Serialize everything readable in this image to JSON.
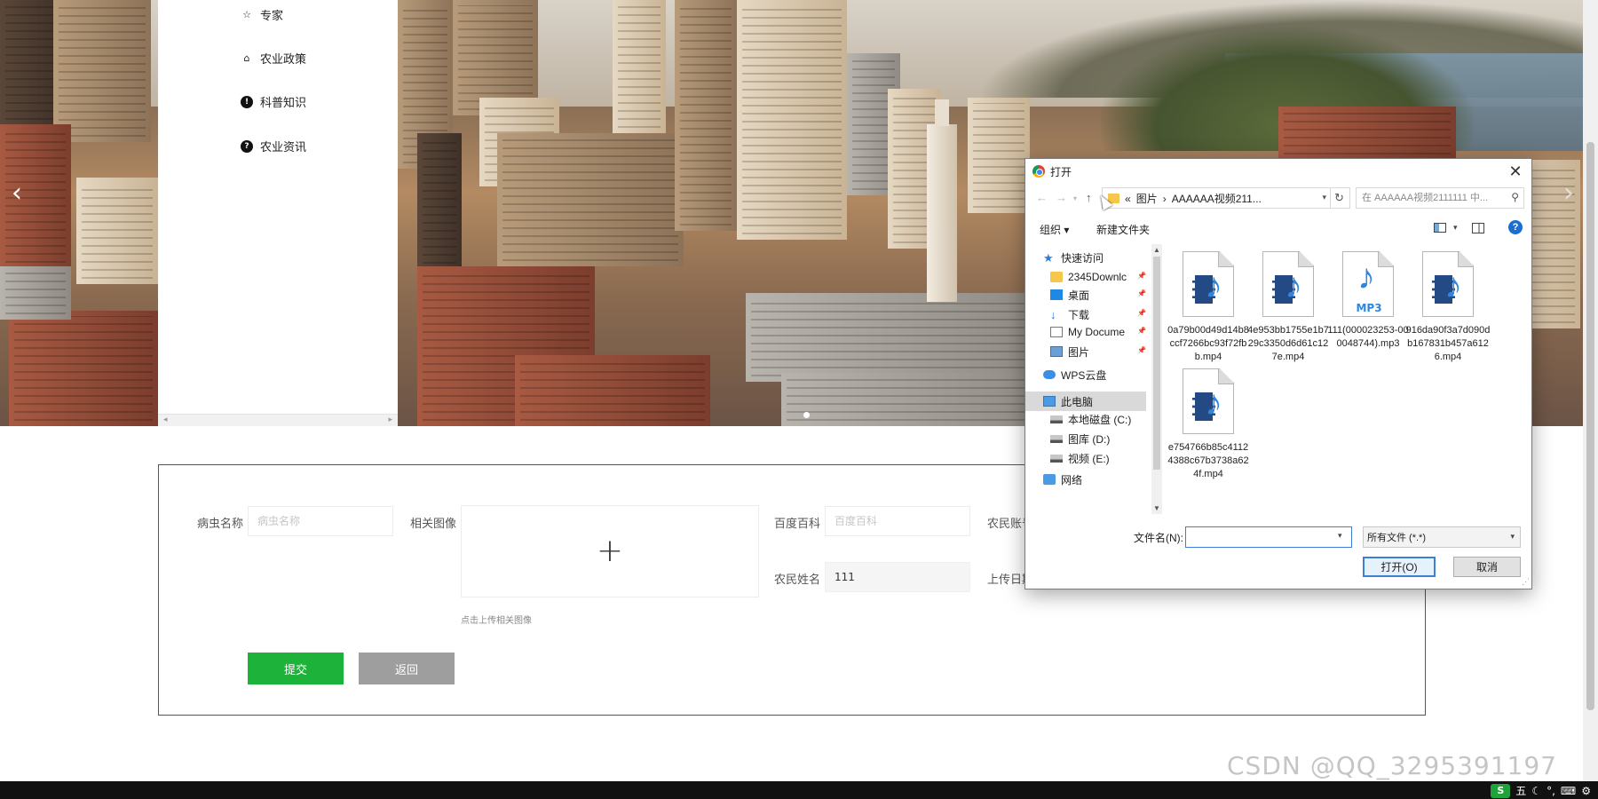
{
  "menu": {
    "items": [
      {
        "label": "专家",
        "icon": "star-outline-icon"
      },
      {
        "label": "农业政策",
        "icon": "bag-icon"
      },
      {
        "label": "科普知识",
        "icon": "exclamation-circle-icon"
      },
      {
        "label": "农业资讯",
        "icon": "question-circle-icon"
      }
    ]
  },
  "carousel": {
    "dot_count": 1,
    "active_dot": 0
  },
  "form": {
    "pest_name_label": "病虫名称",
    "pest_name_placeholder": "病虫名称",
    "image_label": "相关图像",
    "upload_hint": "点击上传相关图像",
    "baike_label": "百度百科",
    "baike_placeholder": "百度百科",
    "farmer_account_label": "农民账号",
    "farmer_name_label": "农民姓名",
    "farmer_name_value": "111",
    "upload_date_label": "上传日期",
    "submit_label": "提交",
    "back_label": "返回"
  },
  "dialog": {
    "title": "打开",
    "breadcrumb": [
      "«",
      "图片",
      "›",
      "AAAAAA视频211..."
    ],
    "search_placeholder": "在 AAAAAA视频2111111 中...",
    "organize_label": "组织 ▾",
    "new_folder_label": "新建文件夹",
    "tree": [
      {
        "label": "快速访问",
        "icon": "star-icon",
        "indent": 1,
        "pinned": false
      },
      {
        "label": "2345Downlc",
        "icon": "folder-icon",
        "indent": 2,
        "pinned": true
      },
      {
        "label": "桌面",
        "icon": "desktop-icon",
        "indent": 2,
        "pinned": true
      },
      {
        "label": "下载",
        "icon": "download-icon",
        "indent": 2,
        "pinned": true
      },
      {
        "label": "My Docume",
        "icon": "document-icon",
        "indent": 2,
        "pinned": true
      },
      {
        "label": "图片",
        "icon": "pictures-icon",
        "indent": 2,
        "pinned": true
      },
      {
        "label": "WPS云盘",
        "icon": "cloud-icon",
        "indent": 1,
        "pinned": false
      },
      {
        "label": "此电脑",
        "icon": "computer-icon",
        "indent": 1,
        "pinned": false,
        "selected": true
      },
      {
        "label": "本地磁盘 (C:)",
        "icon": "drive-icon",
        "indent": 2,
        "pinned": false
      },
      {
        "label": "图库 (D:)",
        "icon": "drive-icon",
        "indent": 2,
        "pinned": false
      },
      {
        "label": "视频 (E:)",
        "icon": "drive-icon",
        "indent": 2,
        "pinned": false
      },
      {
        "label": "网络",
        "icon": "network-icon",
        "indent": 1,
        "pinned": false
      }
    ],
    "files": [
      {
        "name": "0a79b00d49d14b8ccf7266bc93f72fbb.mp4",
        "kind": "video"
      },
      {
        "name": "4e953bb1755e1b729c3350d6d61c127e.mp4",
        "kind": "video"
      },
      {
        "name": "111(000023253-000048744).mp3",
        "kind": "audio",
        "badge": "MP3"
      },
      {
        "name": "916da90f3a7d090db167831b457a6126.mp4",
        "kind": "video"
      },
      {
        "name": "e754766b85c41124388c67b3738a624f.mp4",
        "kind": "video"
      }
    ],
    "filename_label": "文件名(N):",
    "filename_value": "",
    "filetype_value": "所有文件 (*.*)",
    "open_label": "打开(O)",
    "cancel_label": "取消"
  },
  "watermark": "CSDN @QQ_3295391197",
  "taskbar": {
    "ime_label": "S",
    "ime_mode": "五"
  }
}
